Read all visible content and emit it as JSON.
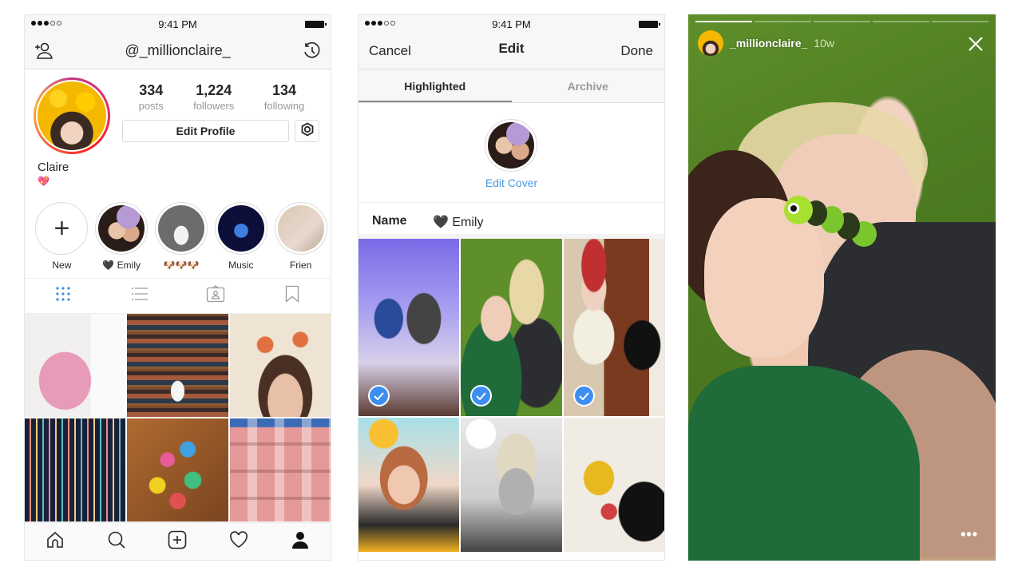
{
  "status_bar": {
    "time": "9:41 PM",
    "signal_bars_filled": 3,
    "signal_bars_total": 5
  },
  "profile": {
    "username": "@_millionclaire_",
    "display_name": "Claire",
    "bio": "💖",
    "stats": [
      {
        "value": "334",
        "label": "posts"
      },
      {
        "value": "1,224",
        "label": "followers"
      },
      {
        "value": "134",
        "label": "following"
      }
    ],
    "edit_profile_label": "Edit Profile",
    "icons": {
      "left": "add-person-icon",
      "right": "archive-history-icon",
      "settings": "gear-icon"
    },
    "highlights": [
      {
        "label": "New",
        "type": "new"
      },
      {
        "label": "🖤 Emily",
        "type": "story"
      },
      {
        "label": "🐶🐶🐶",
        "type": "story"
      },
      {
        "label": "Music",
        "type": "story"
      },
      {
        "label": "Frien",
        "type": "story"
      }
    ],
    "view_tabs": [
      {
        "name": "grid",
        "icon": "grid-icon",
        "active": true
      },
      {
        "name": "list",
        "icon": "list-icon",
        "active": false
      },
      {
        "name": "tagged",
        "icon": "tagged-icon",
        "active": false
      },
      {
        "name": "saved",
        "icon": "bookmark-icon",
        "active": false
      }
    ],
    "photos": [
      "pink beaded purse",
      "bookshelf with stool",
      "mermaid figurines selfie",
      "striped rug with sneakers",
      "origami cranes",
      "pink building fire escape"
    ],
    "bottom_tabs": [
      {
        "name": "home",
        "icon": "home-icon"
      },
      {
        "name": "search",
        "icon": "search-icon"
      },
      {
        "name": "new-post",
        "icon": "plus-square-icon"
      },
      {
        "name": "activity",
        "icon": "heart-icon"
      },
      {
        "name": "profile",
        "icon": "profile-icon",
        "active": true
      }
    ]
  },
  "edit": {
    "cancel_label": "Cancel",
    "title": "Edit",
    "done_label": "Done",
    "tabs": [
      {
        "label": "Highlighted",
        "active": true
      },
      {
        "label": "Archive",
        "active": false
      }
    ],
    "edit_cover_label": "Edit Cover",
    "name_label": "Name",
    "name_value": "🖤 Emily",
    "items": [
      {
        "desc": "party neon arrow",
        "selected": true
      },
      {
        "desc": "grass selfie with caterpillar",
        "selected": true
      },
      {
        "desc": "red beanie mirror",
        "selected": true
      },
      {
        "desc": "sun sticker selfie",
        "selected": false
      },
      {
        "desc": "cloud filter selfie",
        "selected": false
      },
      {
        "desc": "yellow sneakers",
        "selected": false
      }
    ]
  },
  "story": {
    "username": "_millionclaire_",
    "age": "10w",
    "progress_segments": [
      1.0,
      0.0,
      0.0,
      0.0,
      0.0
    ],
    "more_label": "•••",
    "colors": {
      "accent_blue": "#3d8ef0",
      "link_blue": "#4a9be0"
    }
  }
}
